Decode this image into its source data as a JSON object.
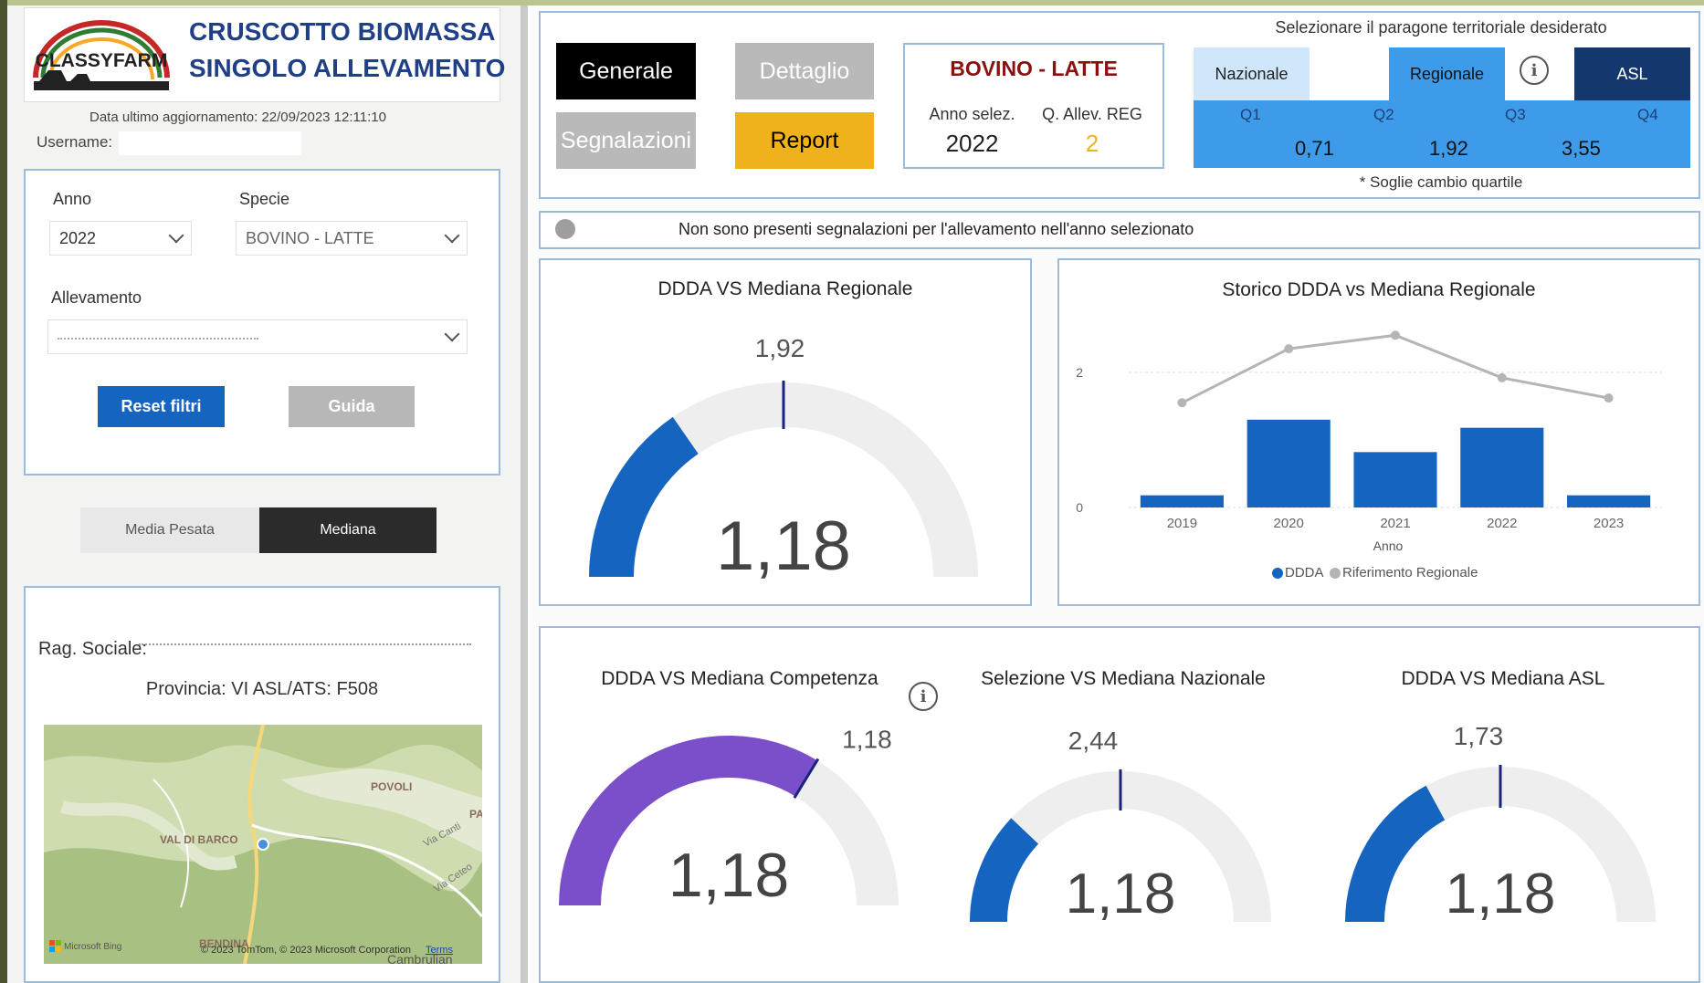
{
  "header": {
    "logo_text": "CLASSYFARM",
    "title_line1": "CRUSCOTTO BIOMASSA",
    "title_line2": "SINGOLO ALLEVAMENTO",
    "last_update": "Data ultimo aggiornamento: 22/09/2023 12:11:10",
    "username_label": "Username:"
  },
  "filters": {
    "anno_label": "Anno",
    "anno_value": "2022",
    "specie_label": "Specie",
    "specie_value": "BOVINO - LATTE",
    "allevamento_label": "Allevamento",
    "reset_label": "Reset filtri",
    "guida_label": "Guida"
  },
  "toggle": {
    "media_pesata": "Media Pesata",
    "mediana": "Mediana"
  },
  "farm": {
    "rag_sociale_label": "Rag. Sociale:",
    "provincia_line": "Provincia: VI  ASL/ATS: F508"
  },
  "map": {
    "labels": [
      "POVOLI",
      "VAL DI BARCO",
      "PA",
      "Via Canti",
      "Via Ceteo",
      "BENDINA",
      "Cambrulian"
    ],
    "bing_label": "Microsoft Bing",
    "copyright": "© 2023 TomTom, © 2023 Microsoft Corporation",
    "terms": "Terms"
  },
  "nav": {
    "generale": "Generale",
    "dettaglio": "Dettaglio",
    "segnalazioni": "Segnalazioni",
    "report": "Report"
  },
  "species_box": {
    "title": "BOVINO - LATTE",
    "anno_label": "Anno selez.",
    "anno_value": "2022",
    "quartile_label": "Q. Allev. REG",
    "quartile_value": "2"
  },
  "territorial": {
    "title": "Selezionare il paragone territoriale desiderato",
    "nazionale": "Nazionale",
    "regionale": "Regionale",
    "asl": "ASL",
    "quartile_labels": [
      "Q1",
      "Q2",
      "Q3",
      "Q4"
    ],
    "thresholds": [
      "0,71",
      "1,92",
      "3,55"
    ],
    "footnote": "* Soglie cambio quartile"
  },
  "alert": {
    "text": "Non sono presenti segnalazioni per l'allevamento nell'anno selezionato"
  },
  "gauges": {
    "regionale": {
      "title": "DDDA VS Mediana Regionale",
      "value": 1.18,
      "value_label": "1,18",
      "target": 1.92,
      "target_label": "1,92",
      "max": 3.84
    },
    "competenza": {
      "title": "DDDA VS Mediana Competenza",
      "value": 1.18,
      "value_label": "1,18",
      "target": 1.18,
      "target_label": "1,18",
      "max": 1.75
    },
    "nazionale": {
      "title": "Selezione VS Mediana Nazionale",
      "value": 1.18,
      "value_label": "1,18",
      "target": 2.44,
      "target_label": "2,44",
      "max": 4.88
    },
    "asl": {
      "title": "DDDA VS Mediana ASL",
      "value": 1.18,
      "value_label": "1,18",
      "target": 1.73,
      "target_label": "1,73",
      "max": 3.46
    }
  },
  "chart_data": {
    "type": "bar",
    "title": "Storico DDDA vs Mediana Regionale",
    "xlabel": "Anno",
    "categories": [
      "2019",
      "2020",
      "2021",
      "2022",
      "2023"
    ],
    "series": [
      {
        "name": "DDDA",
        "type": "bar",
        "values": [
          0.18,
          1.3,
          0.82,
          1.18,
          0.18
        ]
      },
      {
        "name": "Riferimento Regionale",
        "type": "line",
        "values": [
          1.55,
          2.35,
          2.55,
          1.92,
          1.62
        ]
      }
    ],
    "yticks": [
      "0",
      "2"
    ],
    "ylim": [
      0,
      3
    ],
    "legend": "bottom",
    "colors": {
      "bar": "#1565c0",
      "line": "#b5b5b5"
    }
  }
}
